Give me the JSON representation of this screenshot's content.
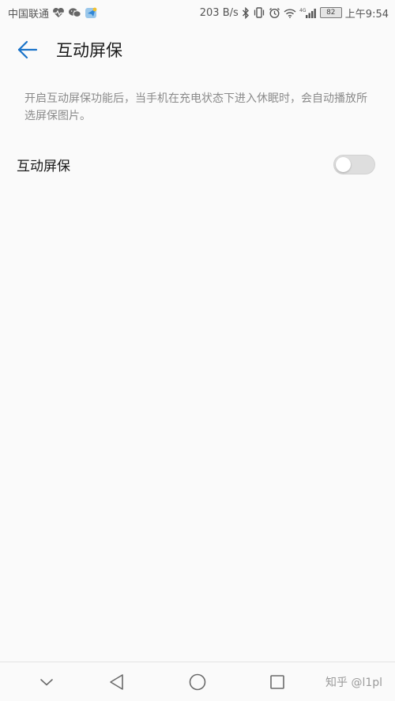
{
  "status_bar": {
    "carrier": "中国联通",
    "speed": "203 B/s",
    "network_type": "4G",
    "battery": "82",
    "time": "上午9:54",
    "left_icons": [
      "health-heart-icon",
      "wechat-icon",
      "app-icon"
    ],
    "right_icons": [
      "bluetooth-icon",
      "vibrate-icon",
      "alarm-icon",
      "wifi-icon",
      "signal-icon",
      "battery-icon"
    ]
  },
  "header": {
    "title": "互动屏保",
    "back_icon": "arrow-left-icon",
    "accent_color": "#1a73c9"
  },
  "description": "开启互动屏保功能后，当手机在充电状态下进入休眠时，会自动播放所选屏保图片。",
  "setting": {
    "label": "互动屏保",
    "enabled": false
  },
  "nav_bar": {
    "buttons": [
      "chevron-down-icon",
      "back-triangle-icon",
      "home-circle-icon",
      "recent-square-icon"
    ],
    "watermark": "知乎 @l1pl"
  }
}
